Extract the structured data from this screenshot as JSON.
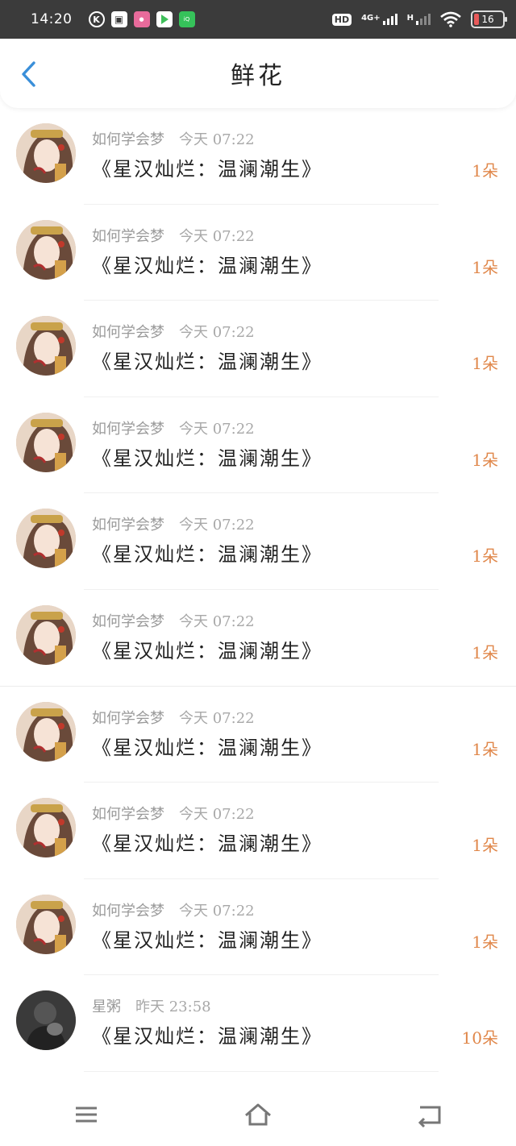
{
  "status_bar": {
    "time": "14:20",
    "apps": [
      "K",
      "猫",
      "饿了么",
      "play",
      "iQIYI"
    ],
    "hd": "HD",
    "sim1": "4G+",
    "sim2": "H",
    "battery": "16",
    "battery_color": "#e85a5a"
  },
  "header": {
    "title": "鲜花",
    "back_icon": "chevron-left-icon",
    "accent": "#3a8fd9"
  },
  "list": {
    "items": [
      {
        "user": "如何学会梦",
        "time": "今天 07:22",
        "title": "《星汉灿烂：温澜潮生》",
        "count": "1朵"
      },
      {
        "user": "如何学会梦",
        "time": "今天 07:22",
        "title": "《星汉灿烂：温澜潮生》",
        "count": "1朵"
      },
      {
        "user": "如何学会梦",
        "time": "今天 07:22",
        "title": "《星汉灿烂：温澜潮生》",
        "count": "1朵"
      },
      {
        "user": "如何学会梦",
        "time": "今天 07:22",
        "title": "《星汉灿烂：温澜潮生》",
        "count": "1朵"
      },
      {
        "user": "如何学会梦",
        "time": "今天 07:22",
        "title": "《星汉灿烂：温澜潮生》",
        "count": "1朵"
      },
      {
        "user": "如何学会梦",
        "time": "今天 07:22",
        "title": "《星汉灿烂：温澜潮生》",
        "count": "1朵"
      },
      {
        "user": "如何学会梦",
        "time": "今天 07:22",
        "title": "《星汉灿烂：温澜潮生》",
        "count": "1朵"
      },
      {
        "user": "如何学会梦",
        "time": "今天 07:22",
        "title": "《星汉灿烂：温澜潮生》",
        "count": "1朵"
      },
      {
        "user": "如何学会梦",
        "time": "今天 07:22",
        "title": "《星汉灿烂：温澜潮生》",
        "count": "1朵"
      },
      {
        "user": "星粥",
        "time": "昨天 23:58",
        "title": "《星汉灿烂：温澜潮生》",
        "count": "10朵"
      }
    ],
    "count_color": "#e0874a"
  },
  "nav": {
    "menu_icon": "menu-icon",
    "home_icon": "home-icon",
    "back_icon": "back-icon"
  }
}
